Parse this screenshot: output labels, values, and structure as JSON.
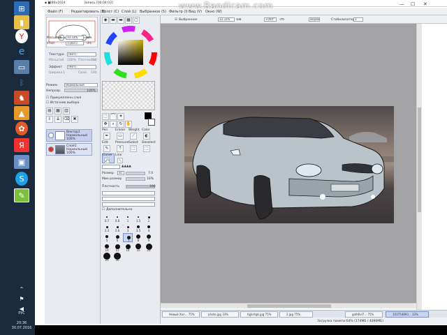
{
  "recorder": {
    "watermark": "www.Bandicam.com"
  },
  "window": {
    "resolution_label": "1280x1024",
    "record_label": "Запись [00:04:03]",
    "doc_label": "103754893..."
  },
  "menu": [
    "Файл (F)",
    "Редактировать (E)",
    "Холст (C)",
    "Слой (L)",
    "Выбранное (S)",
    "Фильтр (I)",
    "Вид (V)",
    "Окно (W)"
  ],
  "nav": {
    "scale_label": "Масштаб",
    "scale_value": "33.33%",
    "angle_label": "Угол",
    "angle_value": "+000.0",
    "texture_label": "Текстура",
    "texture_value": "(Нет)",
    "scale2_label": "Масштаб",
    "scale2_value": "100%",
    "density_label": "Плотность",
    "density_value": "100",
    "effect_label": "Эффект",
    "effect_value": "(Нет)",
    "width_label": "Ширина",
    "width_value": "1",
    "strength_label": "Сила",
    "strength_value": "100"
  },
  "layer_panel": {
    "mode_label": "Режим",
    "mode_value": "Нормальный",
    "opacity_label": "Непрозр.",
    "opacity_value": "100%",
    "clip_label": "Прикрепленн.слоя",
    "sel_label": "Источник выбора"
  },
  "layers": [
    {
      "name": "Вектор1",
      "mode": "Нормальный",
      "opacity": "100%"
    },
    {
      "name": "Слой1",
      "mode": "Нормальный",
      "opacity": "100%"
    }
  ],
  "tools": {
    "row1": [
      "Pen",
      "Eraser",
      "Weight",
      "Color"
    ],
    "row2": [
      "Edit",
      "Pressure",
      "Select",
      "Deselect"
    ],
    "row3": [
      "Curve",
      "Line"
    ],
    "brush_size_label": "Размер",
    "brush_size_mult": "x0.1",
    "brush_size_value": "7.0",
    "min_size_label": "Мин размер",
    "min_size_value": "16%",
    "density_label": "Плотность",
    "density_value": "100",
    "advanced_label": "Дополнительно"
  },
  "brush_sizes": [
    "0.7",
    "0.8",
    "1",
    "1.5",
    "2",
    "2.3",
    "2.6",
    "3",
    "3.5",
    "4",
    "5",
    "6",
    "7",
    "8",
    "9",
    "10",
    "12",
    "14",
    "16",
    "20",
    "25",
    "30"
  ],
  "canvas_toolbar": {
    "select_label": "Выбранное",
    "zoom": "33.33%",
    "angle": "+000°",
    "mode_label": "Нормальный",
    "stabilizer_label": "Стабилизатор",
    "stabilizer_value": "3"
  },
  "tabs": [
    {
      "name": "Новый Хол...",
      "zoom": "75%"
    },
    {
      "name": "photo.jpg",
      "zoom": "33%"
    },
    {
      "name": "fqjkshgk.jpg",
      "zoom": "75%"
    },
    {
      "name": "2.jpg",
      "zoom": "75%"
    },
    {
      "name": "galt4lvl7...",
      "zoom": "75%"
    },
    {
      "name": "103754893...",
      "zoom": "33%"
    }
  ],
  "status": {
    "memory": "Загрузка памяти:64% (174МБ / 4096МБ)"
  },
  "clock": {
    "lang": "РУС",
    "time": "20:36",
    "date": "30.07.2016"
  }
}
